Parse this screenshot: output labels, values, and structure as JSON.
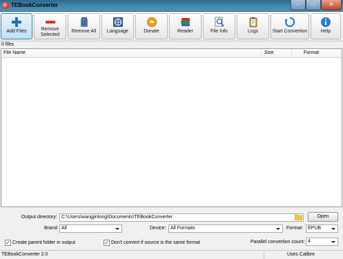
{
  "window": {
    "title": "TEBookConverter",
    "minimize": "–",
    "maximize": "□",
    "close": "✕"
  },
  "toolbar": {
    "add_files": "Add Files",
    "remove_selected": "Remove Selected",
    "remove_all": "Remove All",
    "language": "Language",
    "donate": "Donate",
    "reader": "Reader",
    "file_info": "File Info",
    "logs": "Logs",
    "start_convertion": "Start Convertion",
    "help": "Help"
  },
  "file_count": "0 files",
  "table": {
    "columns": [
      "File Name",
      "Size",
      "Format"
    ]
  },
  "output": {
    "label": "Output directory:",
    "value": "C:\\Users\\wangjinlong\\Documents\\TEBookConverter",
    "open_button": "Open"
  },
  "brand": {
    "label": "Brand:",
    "value": "All"
  },
  "device": {
    "label": "Device:",
    "value": "All Formats"
  },
  "format": {
    "label": "Format:",
    "value": "EPUB"
  },
  "options": {
    "create_parent": {
      "label": "Create parent folder in output",
      "checked": true
    },
    "dont_convert": {
      "label": "Don't convert if source is the same format",
      "checked": true
    }
  },
  "parallel": {
    "label": "Parallel convertion count:",
    "value": "4"
  },
  "status": {
    "version": "TEBookConverter 2.0",
    "engine": "Uses Calibre"
  },
  "colors": {
    "titlebar": "#3f83a8",
    "active_button": "#bfe0f6",
    "accent_blue": "#1f6fc2"
  },
  "icons": [
    "app-icon",
    "add-files-icon",
    "remove-icon",
    "trash-icon",
    "language-icon",
    "donate-icon",
    "reader-icon",
    "file-info-icon",
    "logs-icon",
    "convert-icon",
    "help-icon",
    "folder-icon",
    "checkmark-icon"
  ]
}
